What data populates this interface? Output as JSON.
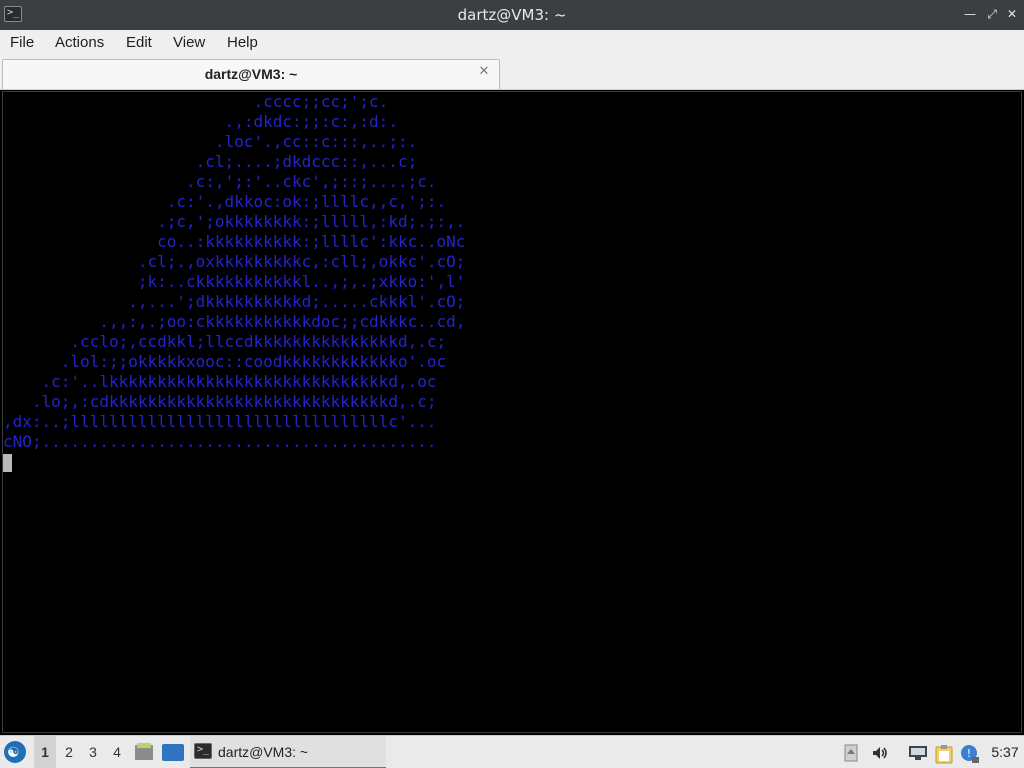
{
  "window": {
    "title": "dartz@VM3: ~",
    "app_icon": "terminal-icon",
    "title_glyph": ">_",
    "controls": {
      "minimize_icon": "minimize-icon",
      "restore_icon": "restore-icon",
      "close_icon": "close-icon"
    },
    "controls_glyphs": {
      "minimize": "—",
      "restore": "⤢",
      "close": "✕"
    }
  },
  "menu": {
    "items": [
      {
        "label": "File"
      },
      {
        "label": "Actions"
      },
      {
        "label": "Edit"
      },
      {
        "label": "View"
      },
      {
        "label": "Help"
      }
    ]
  },
  "tabs": [
    {
      "label": "dartz@VM3: ~",
      "close_glyph": "✕",
      "close_icon": "close-tab-icon"
    }
  ],
  "terminal": {
    "text_color": "#2424c8",
    "background": "#000000",
    "lines": [
      "                          .cccc;;cc;';c.",
      "                       .,:dkdc:;;:c:,:d:.",
      "                      .loc'.,cc::c:::,..;:.",
      "                    .cl;....;dkdccc::,...c;",
      "                   .c:,';:'..ckc',;::;....;c.",
      "                 .c:'.,dkkoc:ok:;llllc,,c,';:.",
      "                .;c,';okkkkkkkk:;lllll,:kd;.;:,.",
      "                co..:kkkkkkkkkk:;llllc':kkc..oNc",
      "              .cl;.,oxkkkkkkkkkc,:cll;,okkc'.cO;",
      "              ;k:..ckkkkkkkkkkkl..,;,.;xkko:',l'",
      "             .,...';dkkkkkkkkkkd;.....ckkkl'.cO;",
      "          .,,:,.;oo:ckkkkkkkkkkkdoc;;cdkkkc..cd,",
      "       .cclo;,ccdkkl;llccdkkkkkkkkkkkkkkkd,.c;",
      "      .lol:;;okkkkkxooc::coodkkkkkkkkkkkko'.oc",
      "    .c:'..lkkkkkkkkkkkkkkkkkkkkkkkkkkkkkd,.oc",
      "   .lo;,:cdkkkkkkkkkkkkkkkkkkkkkkkkkkkkkd,.c;",
      ",dx:..;lllllllllllllllllllllllllllllllllc'...",
      "cNO;........................................."
    ]
  },
  "taskbar": {
    "start_icon": "lxqt-start-icon",
    "start_glyph": "☯",
    "workspaces": [
      {
        "label": "1",
        "active": true
      },
      {
        "label": "2",
        "active": false
      },
      {
        "label": "3",
        "active": false
      },
      {
        "label": "4",
        "active": false
      }
    ],
    "launchers": [
      "file-manager-icon",
      "show-desktop-icon"
    ],
    "task": {
      "label": "dartz@VM3: ~",
      "icon": "terminal-icon",
      "glyph": ">_"
    },
    "tray": [
      "scroll-up-icon",
      "volume-icon",
      "network-icon",
      "clipboard-icon",
      "update-notifier-icon"
    ],
    "clock": "5:37"
  },
  "colors": {
    "titlebar": "#3c3f41",
    "menubar": "#efefef",
    "terminal_text": "#2424c8",
    "accent": "#3b7fd4"
  }
}
